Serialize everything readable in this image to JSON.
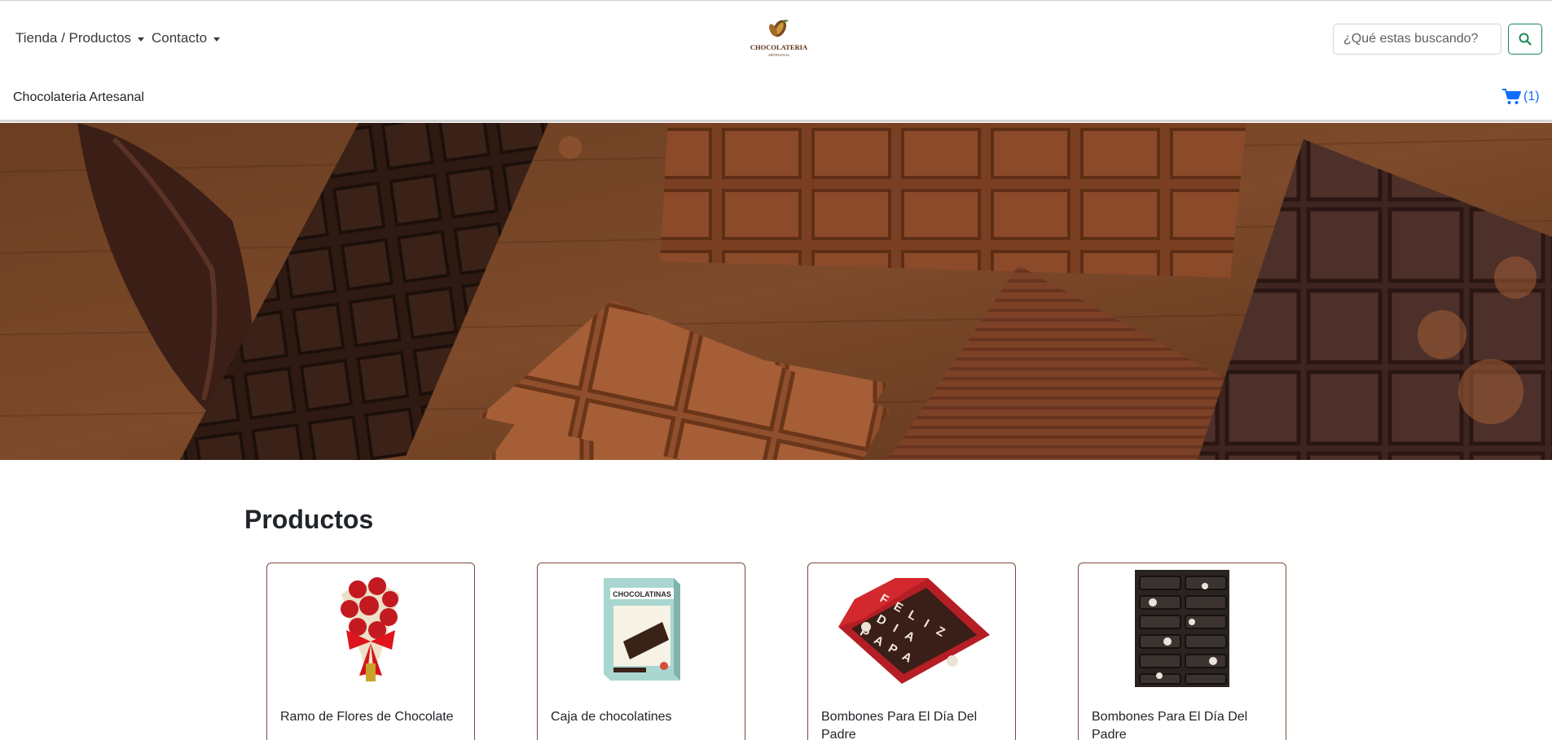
{
  "nav": {
    "shop_label": "Tienda / Productos",
    "contact_label": "Contacto"
  },
  "logo": {
    "line1": "CHOCOLATERIA",
    "line2": "ARTESANAL"
  },
  "search": {
    "placeholder": "¿Qué estas buscando?",
    "value": ""
  },
  "brand": "Chocolateria Artesanal",
  "cart": {
    "count_label": "(1)"
  },
  "products_title": "Productos",
  "products": [
    {
      "name": "Ramo de Flores de Chocolate",
      "icon": "rose-bouquet-image"
    },
    {
      "name": "Caja de chocolatines",
      "icon": "chocolatines-box-image",
      "box_text": "CHOCOLATINAS"
    },
    {
      "name": "Bombones Para El Día Del Padre",
      "icon": "feliz-dia-papa-box-image",
      "letters": [
        "F",
        "E",
        "L",
        "I",
        "Z",
        "D",
        "I",
        "A",
        "P",
        "A",
        "P",
        "A"
      ]
    },
    {
      "name": "Bombones Para El Día Del Padre",
      "icon": "dark-bonbons-box-image"
    }
  ],
  "colors": {
    "accent_green": "#198754",
    "cart_blue": "#0d6efd",
    "card_border": "#7a4a3a"
  }
}
